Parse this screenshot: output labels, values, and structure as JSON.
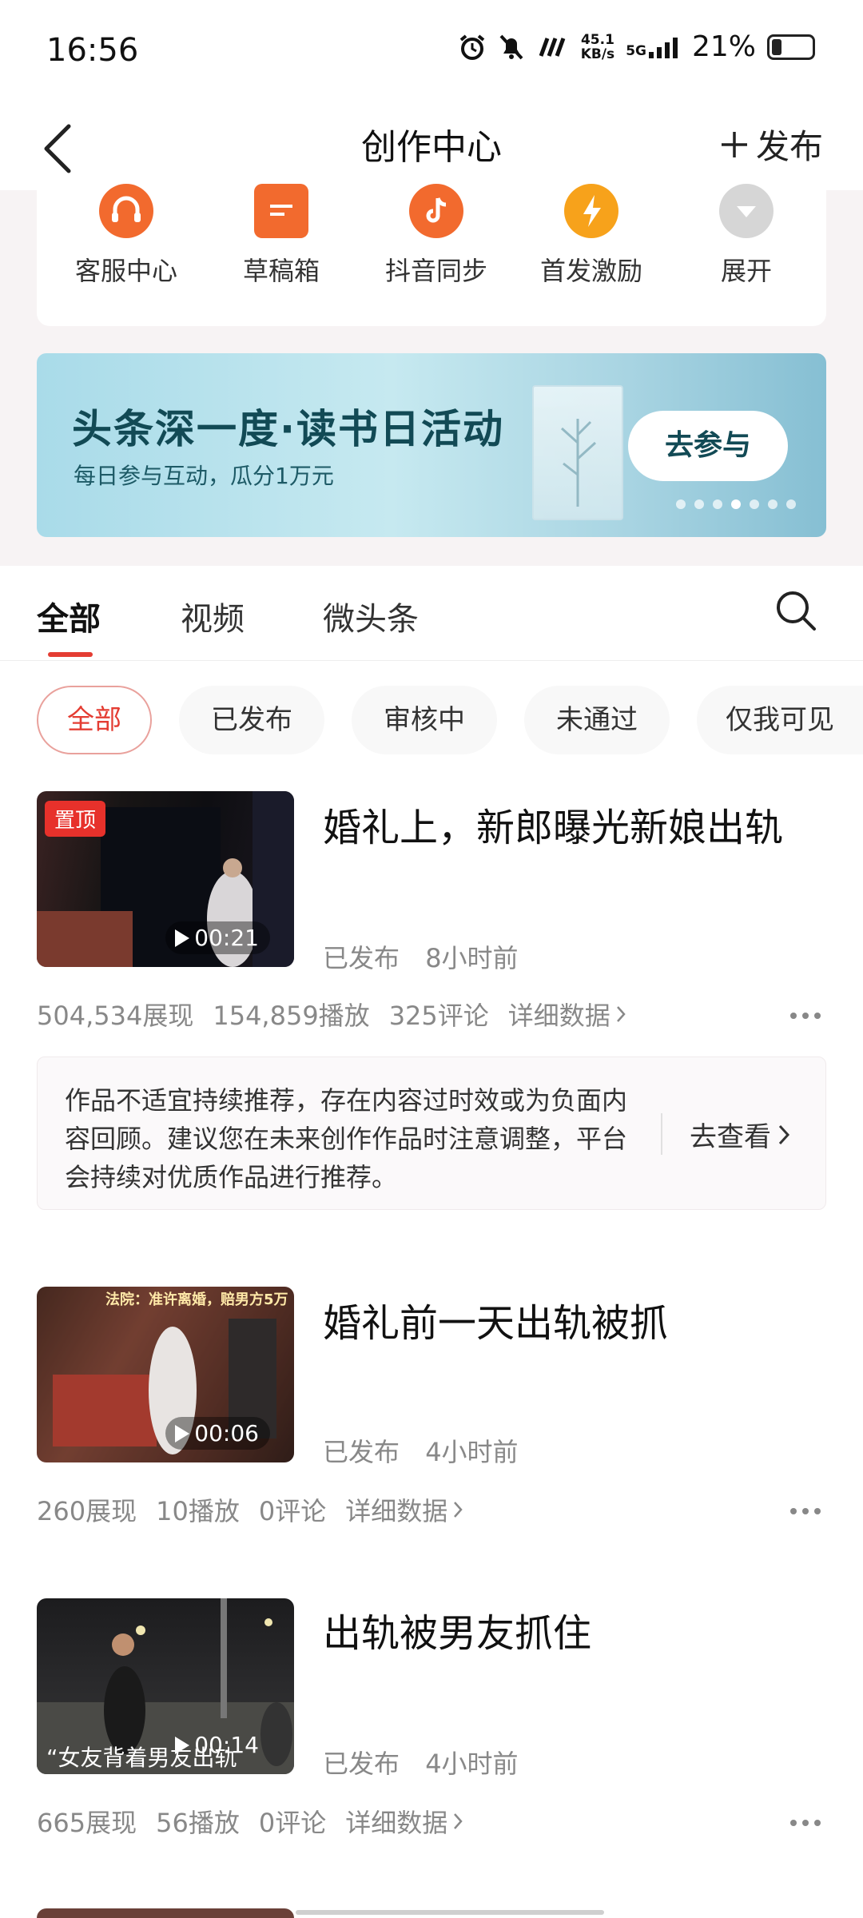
{
  "status_bar": {
    "time": "16:56",
    "net_speed_value": "45.1",
    "net_speed_unit": "KB/s",
    "network_type": "5G",
    "battery_percent": "21%"
  },
  "header": {
    "title": "创作中心",
    "publish_label": "发布"
  },
  "quick_actions": [
    {
      "label": "客服中心",
      "icon": "headset-icon",
      "color": "#f26a2e"
    },
    {
      "label": "草稿箱",
      "icon": "draft-icon",
      "color": "#f26a2e"
    },
    {
      "label": "抖音同步",
      "icon": "douyin-icon",
      "color": "#f26a2e"
    },
    {
      "label": "首发激励",
      "icon": "lightning-icon",
      "color": "#f7a21b"
    },
    {
      "label": "展开",
      "icon": "chevron-down-icon",
      "color": "#c8c8c8"
    }
  ],
  "banner": {
    "title": "头条深一度·读书日活动",
    "subtitle": "每日参与互动，瓜分1万元",
    "button": "去参与",
    "active_slide": 4,
    "slide_count": 7
  },
  "tabs": [
    {
      "label": "全部",
      "active": true
    },
    {
      "label": "视频",
      "active": false
    },
    {
      "label": "微头条",
      "active": false
    }
  ],
  "filters": [
    {
      "label": "全部",
      "active": true
    },
    {
      "label": "已发布",
      "active": false
    },
    {
      "label": "审核中",
      "active": false
    },
    {
      "label": "未通过",
      "active": false
    },
    {
      "label": "仅我可见",
      "active": false
    }
  ],
  "items": [
    {
      "title": "婚礼上，新郎曝光新娘出轨",
      "status": "已发布",
      "time": "8小时前",
      "duration": "00:21",
      "pin_label": "置顶",
      "impressions": "504,534展现",
      "plays": "154,859播放",
      "comments": "325评论",
      "detail": "详细数据"
    },
    {
      "title": "婚礼前一天出轨被抓",
      "status": "已发布",
      "time": "4小时前",
      "duration": "00:06",
      "thumb_caption": "法院：准许离婚，赔男方5万",
      "impressions": "260展现",
      "plays": "10播放",
      "comments": "0评论",
      "detail": "详细数据"
    },
    {
      "title": "出轨被男友抓住",
      "status": "已发布",
      "time": "4小时前",
      "duration": "00:14",
      "thumb_caption": "“女友背着男友出轨",
      "impressions": "665展现",
      "plays": "56播放",
      "comments": "0评论",
      "detail": "详细数据"
    }
  ],
  "notice": {
    "text": "作品不适宜持续推荐，存在内容过时效或为负面内容回顾。建议您在未来创作作品时注意调整，平台会持续对优质作品进行推荐。",
    "button": "去查看"
  },
  "colors": {
    "accent": "#e43d33",
    "orange": "#f26a2e",
    "banner_text": "#124a55"
  }
}
